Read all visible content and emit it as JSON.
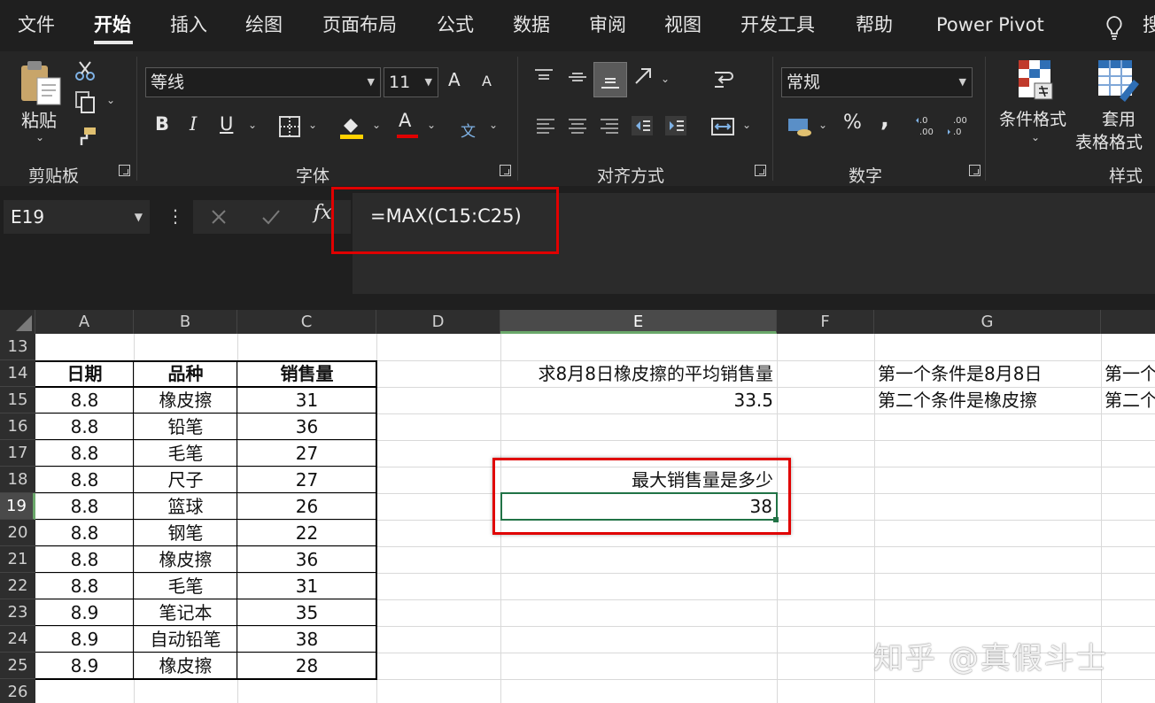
{
  "ribbon_tabs": [
    {
      "label": "文件",
      "active": false
    },
    {
      "label": "开始",
      "active": true
    },
    {
      "label": "插入",
      "active": false
    },
    {
      "label": "绘图",
      "active": false
    },
    {
      "label": "页面布局",
      "active": false
    },
    {
      "label": "公式",
      "active": false
    },
    {
      "label": "数据",
      "active": false
    },
    {
      "label": "审阅",
      "active": false
    },
    {
      "label": "视图",
      "active": false
    },
    {
      "label": "开发工具",
      "active": false
    },
    {
      "label": "帮助",
      "active": false
    },
    {
      "label": "Power Pivot",
      "active": false
    }
  ],
  "tell_me_partial": "搜",
  "clipboard": {
    "paste_label": "粘贴",
    "group_label": "剪贴板"
  },
  "font": {
    "name": "等线",
    "size": "11",
    "group_label": "字体",
    "bold": "B",
    "italic": "I",
    "underline": "U",
    "grow": "A",
    "shrink": "A",
    "font_color_letter": "A",
    "phonetic": "文"
  },
  "alignment": {
    "group_label": "对齐方式"
  },
  "number": {
    "format": "常规",
    "group_label": "数字",
    "percent": "%",
    "comma": ","
  },
  "styles": {
    "conditional_label": "条件格式",
    "table_label_1": "套用",
    "table_label_2": "表格格式",
    "group_label": "样式"
  },
  "formula_bar": {
    "name_box": "E19",
    "formula": "=MAX(C15:C25)"
  },
  "columns": [
    "A",
    "B",
    "C",
    "D",
    "E",
    "F",
    "G"
  ],
  "selected_column": "E",
  "rows": [
    "13",
    "14",
    "15",
    "16",
    "17",
    "18",
    "19",
    "20",
    "21",
    "22",
    "23",
    "24",
    "25",
    "26"
  ],
  "selected_row": "19",
  "table": {
    "headers": [
      "日期",
      "品种",
      "销售量"
    ],
    "rows": [
      [
        "8.8",
        "橡皮擦",
        "31"
      ],
      [
        "8.8",
        "铅笔",
        "36"
      ],
      [
        "8.8",
        "毛笔",
        "27"
      ],
      [
        "8.8",
        "尺子",
        "27"
      ],
      [
        "8.8",
        "篮球",
        "26"
      ],
      [
        "8.8",
        "钢笔",
        "22"
      ],
      [
        "8.8",
        "橡皮擦",
        "36"
      ],
      [
        "8.8",
        "毛笔",
        "31"
      ],
      [
        "8.9",
        "笔记本",
        "35"
      ],
      [
        "8.9",
        "自动铅笔",
        "38"
      ],
      [
        "8.9",
        "橡皮擦",
        "28"
      ]
    ]
  },
  "cells": {
    "e14": "求8月8日橡皮擦的平均销售量",
    "e15": "33.5",
    "e18": "最大销售量是多少",
    "e19": "38",
    "g14": "第一个条件是8月8日",
    "g15": "第二个条件是橡皮擦",
    "h14": "第一个",
    "h15": "第二个"
  },
  "watermark": "知乎 @真假斗士",
  "colors": {
    "highlight": "#e00000",
    "selection": "#217346"
  }
}
